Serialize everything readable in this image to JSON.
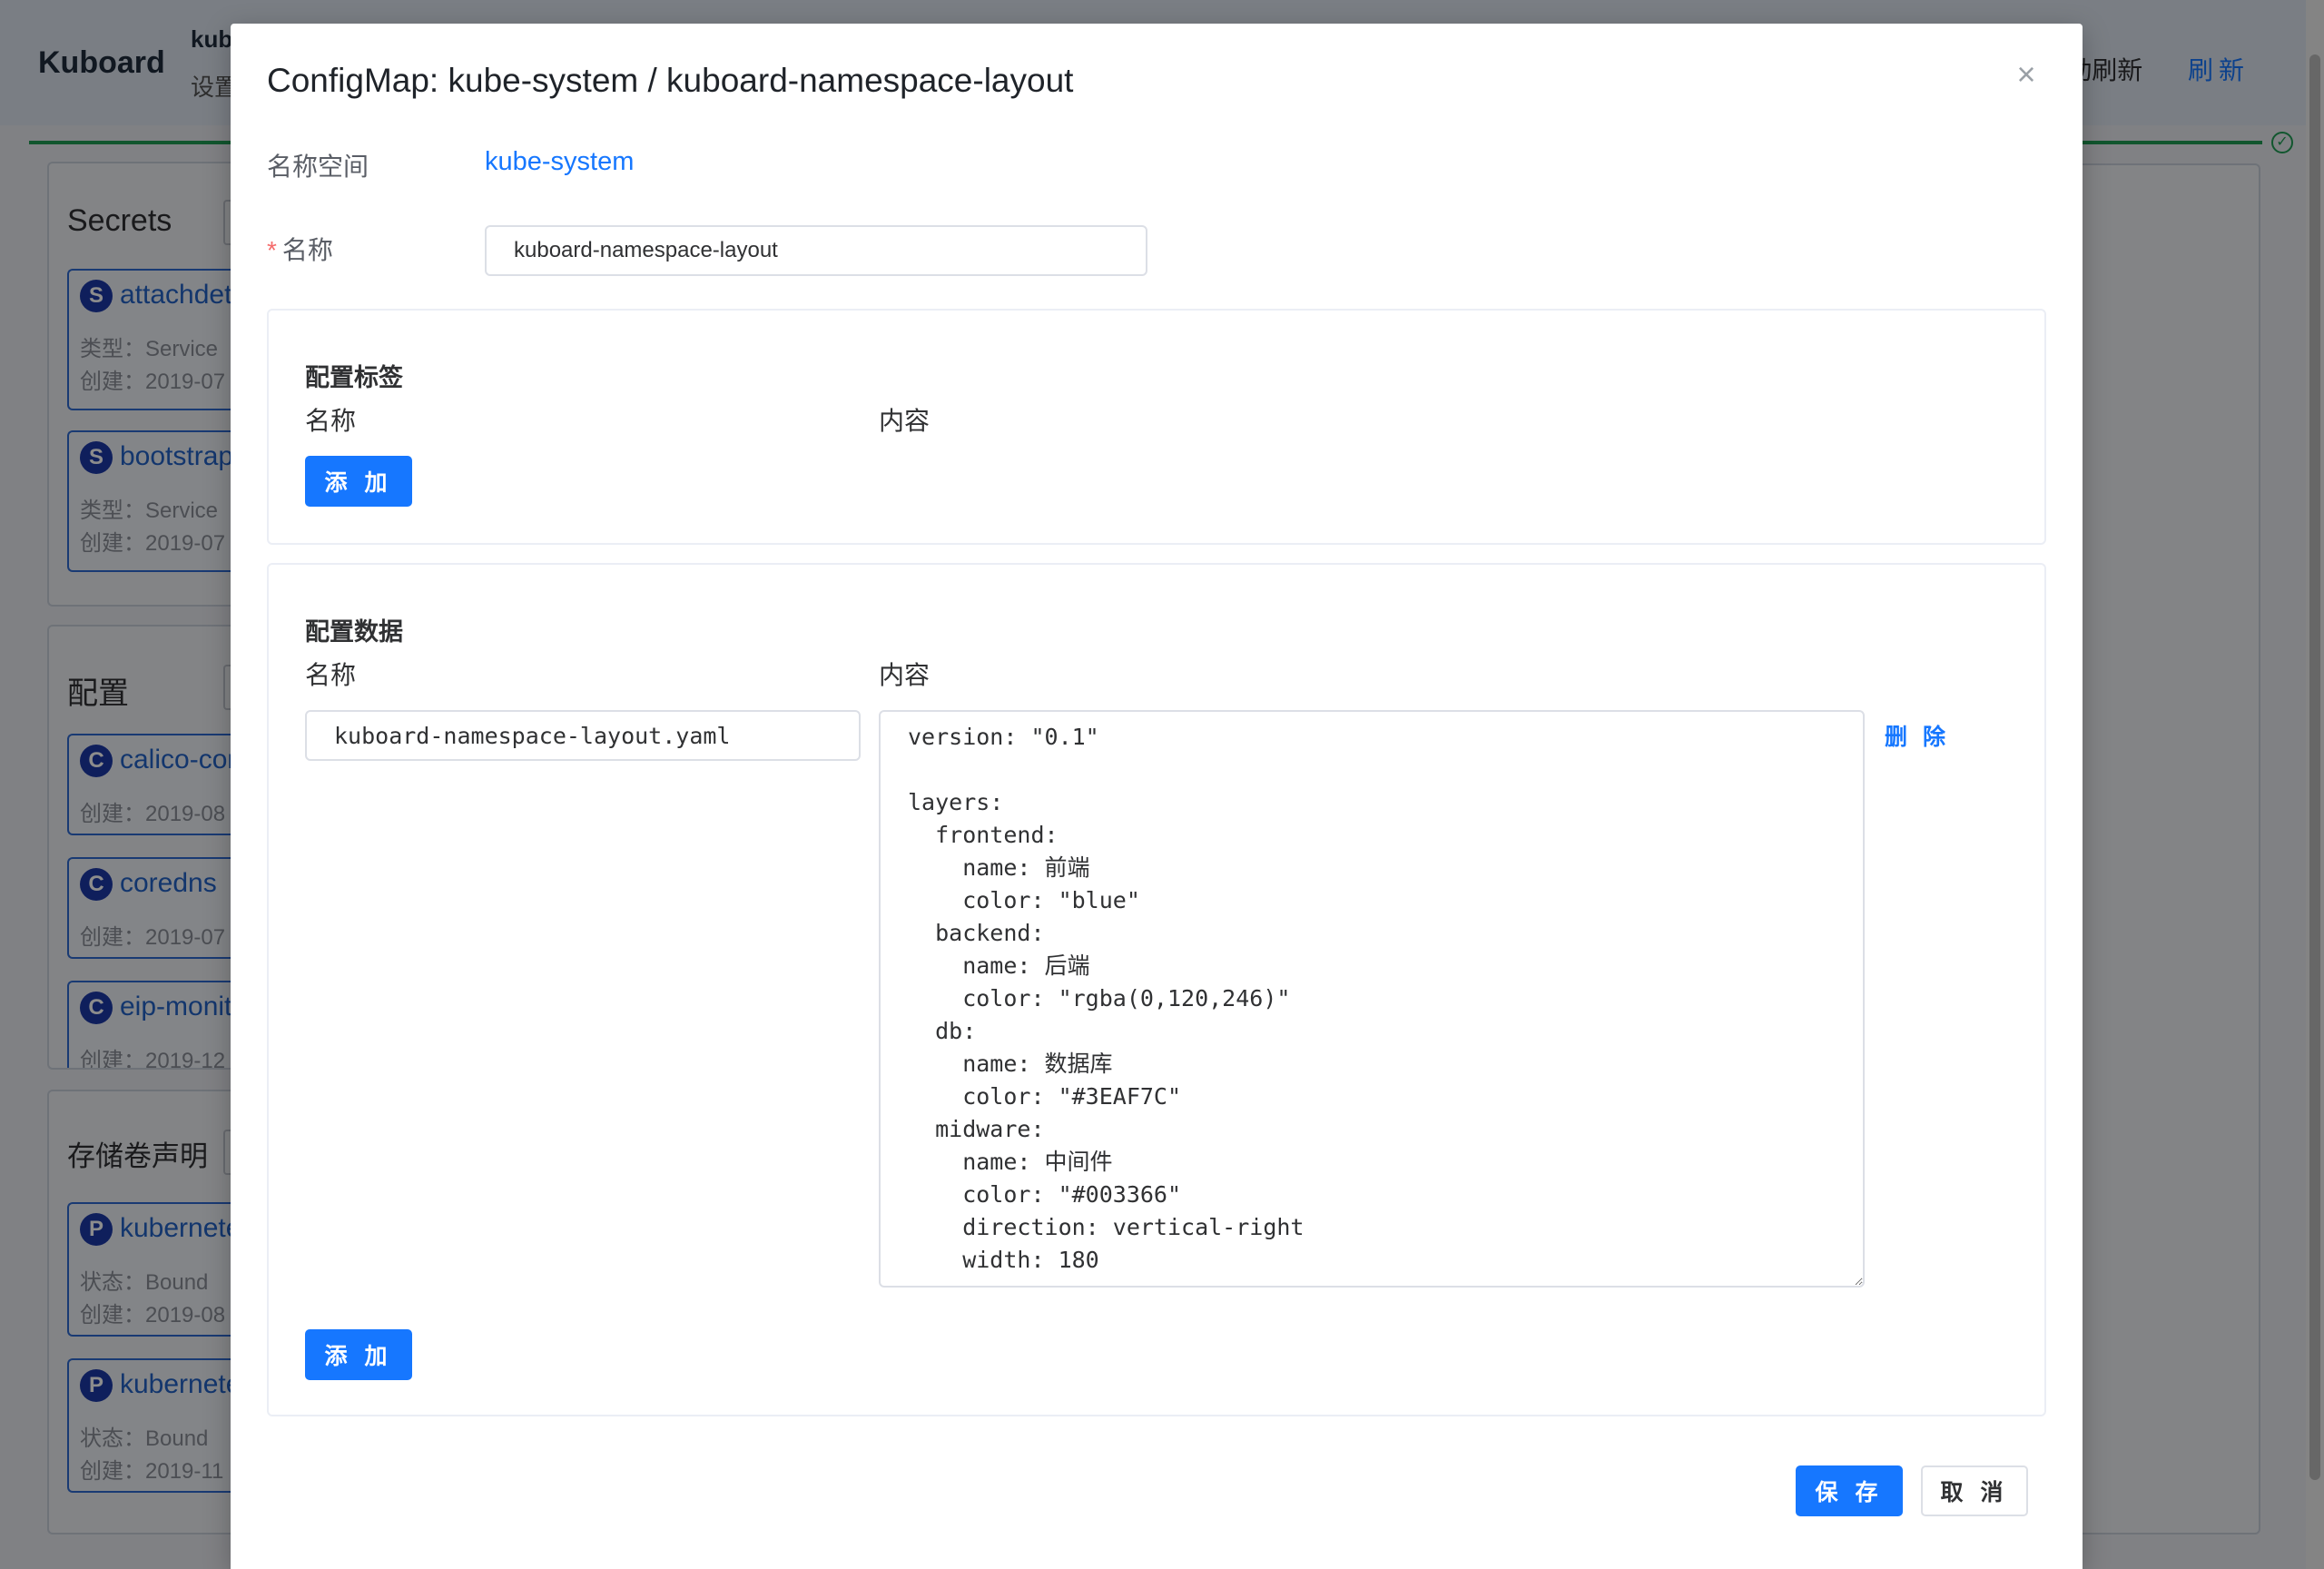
{
  "app": {
    "brand": "Kuboard",
    "context_title": "kube-system",
    "context_sub": "设置",
    "auto_refresh_label": "自动刷新",
    "refresh_label": "刷新"
  },
  "background": {
    "panels": [
      {
        "title": "Secrets",
        "cards": [
          {
            "badge": "S",
            "name": "attachdetach-controller-token",
            "meta": [
              "类型：Service",
              "创建：2019-07"
            ]
          },
          {
            "badge": "S",
            "name": "bootstrap-signer-token",
            "meta": [
              "类型：Service",
              "创建：2019-07"
            ]
          }
        ]
      },
      {
        "title": "配置",
        "cards": [
          {
            "badge": "C",
            "name": "calico-config",
            "meta": [
              "创建：2019-08"
            ]
          },
          {
            "badge": "C",
            "name": "coredns",
            "meta": [
              "创建：2019-07"
            ]
          },
          {
            "badge": "C",
            "name": "eip-monitor",
            "meta": [
              "创建：2019-12"
            ]
          }
        ]
      },
      {
        "title": "存储卷声明",
        "cards": [
          {
            "badge": "P",
            "name": "kubernetes-pvc",
            "meta": [
              "状态：Bound",
              "创建：2019-08"
            ]
          },
          {
            "badge": "P",
            "name": "kubernetes-pvc",
            "meta": [
              "状态：Bound",
              "创建：2019-11"
            ]
          }
        ]
      }
    ]
  },
  "modal": {
    "title": "ConfigMap: kube-system / kuboard-namespace-layout",
    "namespace_label": "名称空间",
    "namespace_value": "kube-system",
    "name_label": "名称",
    "name_required_mark": "*",
    "name_value": "kuboard-namespace-layout",
    "labels_section": {
      "title": "配置标签",
      "col_name": "名称",
      "col_content": "内容",
      "add_label": "添 加"
    },
    "data_section": {
      "title": "配置数据",
      "col_name": "名称",
      "col_content": "内容",
      "entries": [
        {
          "key": "kuboard-namespace-layout.yaml",
          "value": "version: \"0.1\"\n\nlayers:\n  frontend:\n    name: 前端\n    color: \"blue\"\n  backend:\n    name: 后端\n    color: \"rgba(0,120,246)\"\n  db:\n    name: 数据库\n    color: \"#3EAF7C\"\n  midware:\n    name: 中间件\n    color: \"#003366\"\n    direction: vertical-right\n    width: 180",
          "delete_label": "删 除"
        }
      ],
      "add_label": "添 加"
    },
    "save_label": "保 存",
    "cancel_label": "取 消"
  }
}
